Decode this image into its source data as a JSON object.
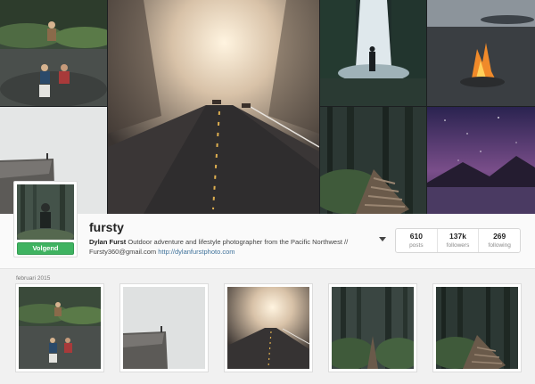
{
  "profile": {
    "username": "fursty",
    "full_name": "Dylan Furst",
    "bio": "Outdoor adventure and lifestyle photographer from the Pacific Northwest // Fursty360@gmail.com",
    "website": "http://dylanfurstphoto.com",
    "follow_button_label": "Volgend"
  },
  "stats": [
    {
      "value": "610",
      "label": "posts"
    },
    {
      "value": "137k",
      "label": "followers"
    },
    {
      "value": "269",
      "label": "following"
    }
  ],
  "feed": {
    "date_label": "februari 2015",
    "photos": [
      {
        "scene": "friends-sitting-on-rocks"
      },
      {
        "scene": "person-on-foggy-cliff"
      },
      {
        "scene": "foggy-road-with-deer"
      },
      {
        "scene": "forest-trail"
      },
      {
        "scene": "forest-stairs"
      }
    ]
  },
  "cover": {
    "tiles": [
      {
        "scene": "friends-sitting-on-rocks"
      },
      {
        "scene": "foggy-road-with-deer"
      },
      {
        "scene": "waterfall-with-hiker"
      },
      {
        "scene": "campfire-by-lake"
      },
      {
        "scene": "person-on-foggy-cliff"
      },
      {
        "scene": "forest-stairs"
      },
      {
        "scene": "starry-sky-over-lake"
      }
    ]
  },
  "colors": {
    "follow_green": "#3fb361",
    "link_blue": "#3f729b"
  }
}
